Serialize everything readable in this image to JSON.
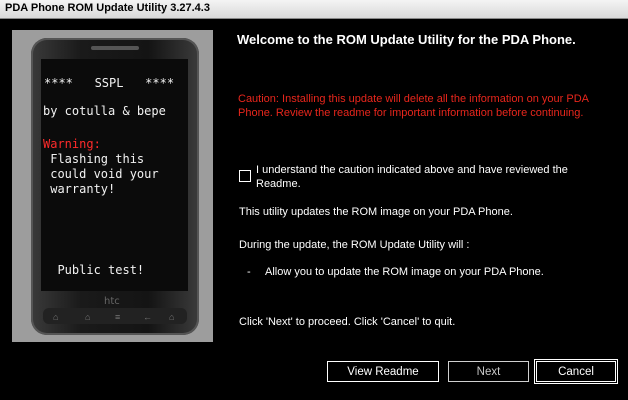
{
  "window": {
    "title": "PDA Phone ROM Update Utility 3.27.4.3"
  },
  "phone": {
    "lines": [
      "****   SSPL   ****",
      "by cotulla & bepe",
      "Warning:",
      " Flashing this",
      " could void your",
      " warranty!",
      "  Public test!"
    ],
    "brand": "htc"
  },
  "main": {
    "heading": "Welcome to the ROM Update Utility for the PDA Phone.",
    "caution": "Caution: Installing this update will delete all the information on your PDA Phone. Review the readme for important information before continuing.",
    "checkbox_label": "I understand the caution indicated above and have reviewed the Readme.",
    "info": "This utility updates the ROM image on your PDA Phone.",
    "during": "During the update, the ROM Update Utility will :",
    "bullet_dash": "-",
    "bullet": "Allow you to update the ROM image on your PDA Phone.",
    "proceed": "Click 'Next' to proceed. Click 'Cancel' to quit."
  },
  "buttons": {
    "readme": "View Readme",
    "next": "Next",
    "cancel": "Cancel"
  },
  "colors": {
    "caution": "#e8261c",
    "background": "#000000",
    "panel": "#9d9d9d"
  }
}
